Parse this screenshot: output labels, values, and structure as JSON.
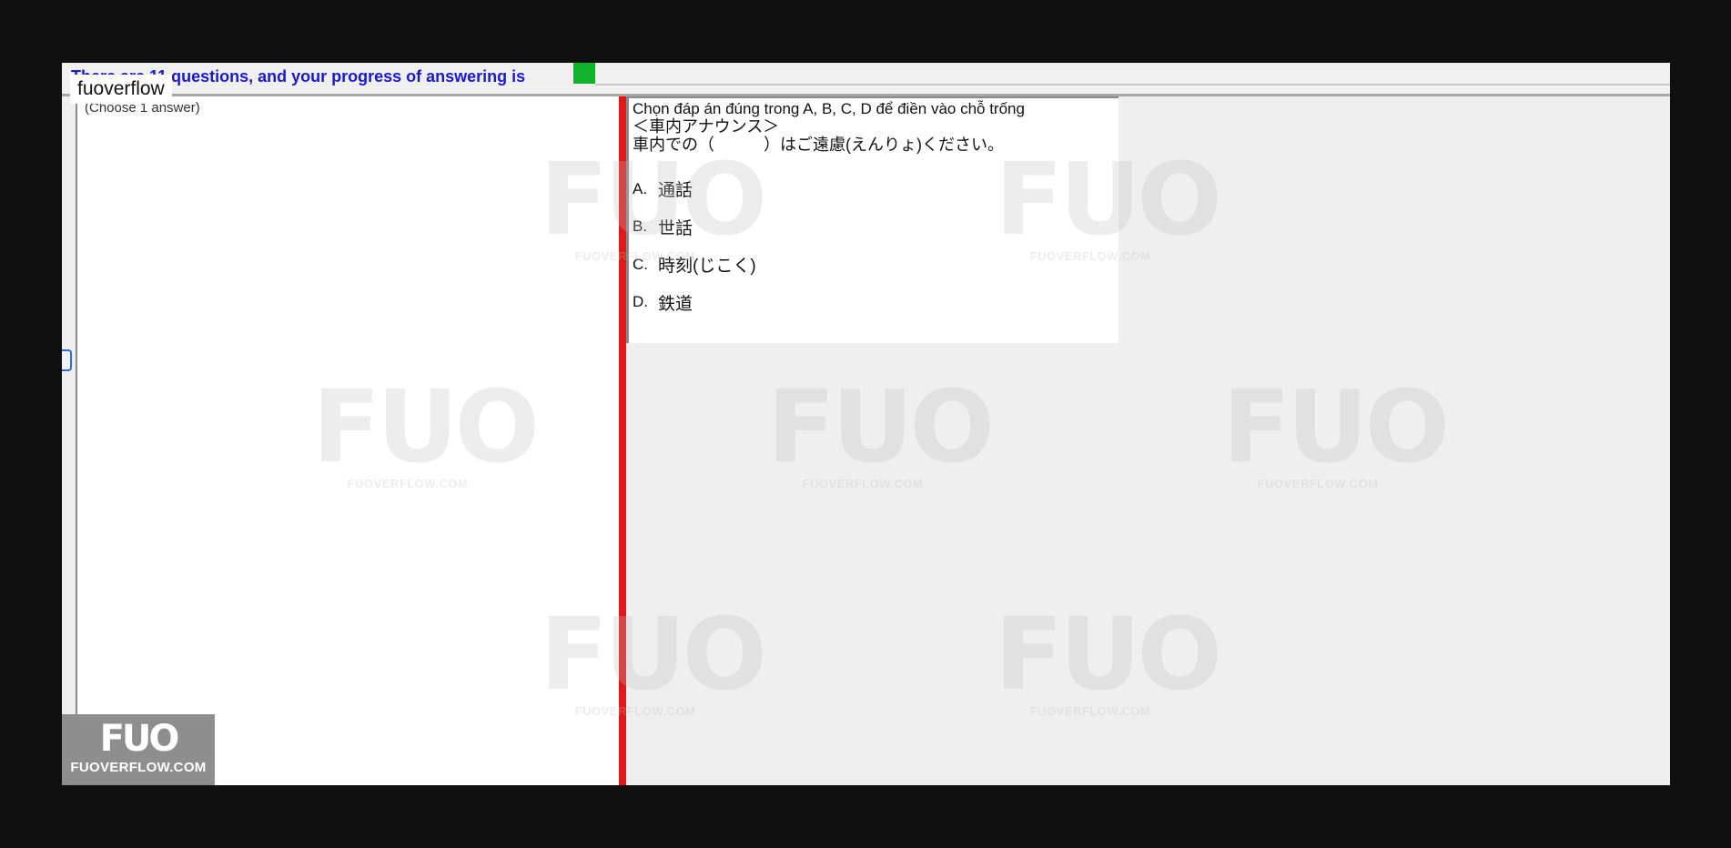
{
  "window": {
    "tab_label": "fuoverflow",
    "progress_text": "There are 11 questions, and your progress of answering is"
  },
  "left_pane": {
    "choose_label": "(Choose 1 answer)"
  },
  "question": {
    "instruction": "Chọn đáp án đúng trong A, B, C, D để điền vào chỗ trống",
    "line1": "＜車内アナウンス＞",
    "line2": "車内での（　　　）はご遠慮(えんりょ)ください。",
    "options": [
      {
        "letter": "A.",
        "text": "通話"
      },
      {
        "letter": "B.",
        "text": "世話"
      },
      {
        "letter": "C.",
        "text": "時刻(じこく)"
      },
      {
        "letter": "D.",
        "text": "鉄道"
      }
    ]
  },
  "watermark": {
    "mark": "FUO",
    "text": "FUOVERFLOW.COM"
  },
  "logo": {
    "mark": "FUO",
    "text": "FUOVERFLOW.COM"
  },
  "colors": {
    "progress": "#12b12c",
    "splitter": "#e01818",
    "progress_text": "#1a1acc"
  }
}
